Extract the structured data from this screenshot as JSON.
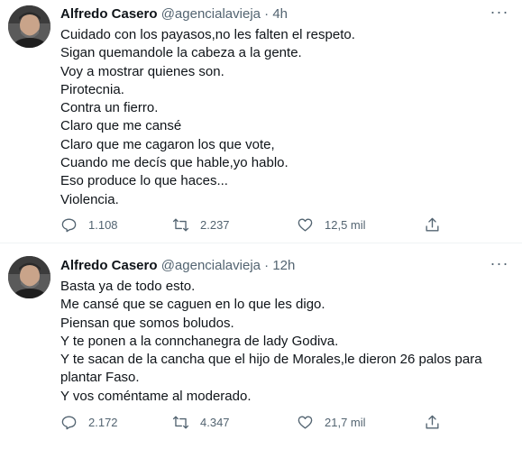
{
  "tweets": [
    {
      "author_name": "Alfredo Casero",
      "handle": "@agencialavieja",
      "separator": "·",
      "time": "4h",
      "lines": [
        "Cuidado con los payasos,no les falten el respeto.",
        "Sigan quemandole la cabeza a la gente.",
        "Voy a mostrar quienes son.",
        "Pirotecnia.",
        "Contra un fierro.",
        "Claro que me cansé",
        "Claro que me cagaron los que vote,",
        "Cuando me decís que hable,yo hablo.",
        "Eso produce lo que haces...",
        "Violencia."
      ],
      "replies": "1.108",
      "retweets": "2.237",
      "likes": "12,5 mil"
    },
    {
      "author_name": "Alfredo Casero",
      "handle": "@agencialavieja",
      "separator": "·",
      "time": "12h",
      "lines": [
        "Basta ya de todo esto.",
        "Me cansé que se caguen en lo que les digo.",
        "Piensan que somos boludos.",
        "Y te ponen a la connchanegra de lady Godiva.",
        "Y te sacan de la cancha que el hijo de Morales,le dieron 26 palos para",
        "plantar Faso.",
        "Y vos coméntame al moderado."
      ],
      "replies": "2.172",
      "retweets": "4.347",
      "likes": "21,7 mil"
    }
  ],
  "icons": {
    "avatar": "profile-photo",
    "more": "more-horizontal-icon",
    "reply": "reply-icon",
    "retweet": "retweet-icon",
    "like": "like-heart-icon",
    "share": "share-icon"
  },
  "colors": {
    "text": "#0f1419",
    "secondary": "#536471",
    "divider": "#eff3f4"
  }
}
